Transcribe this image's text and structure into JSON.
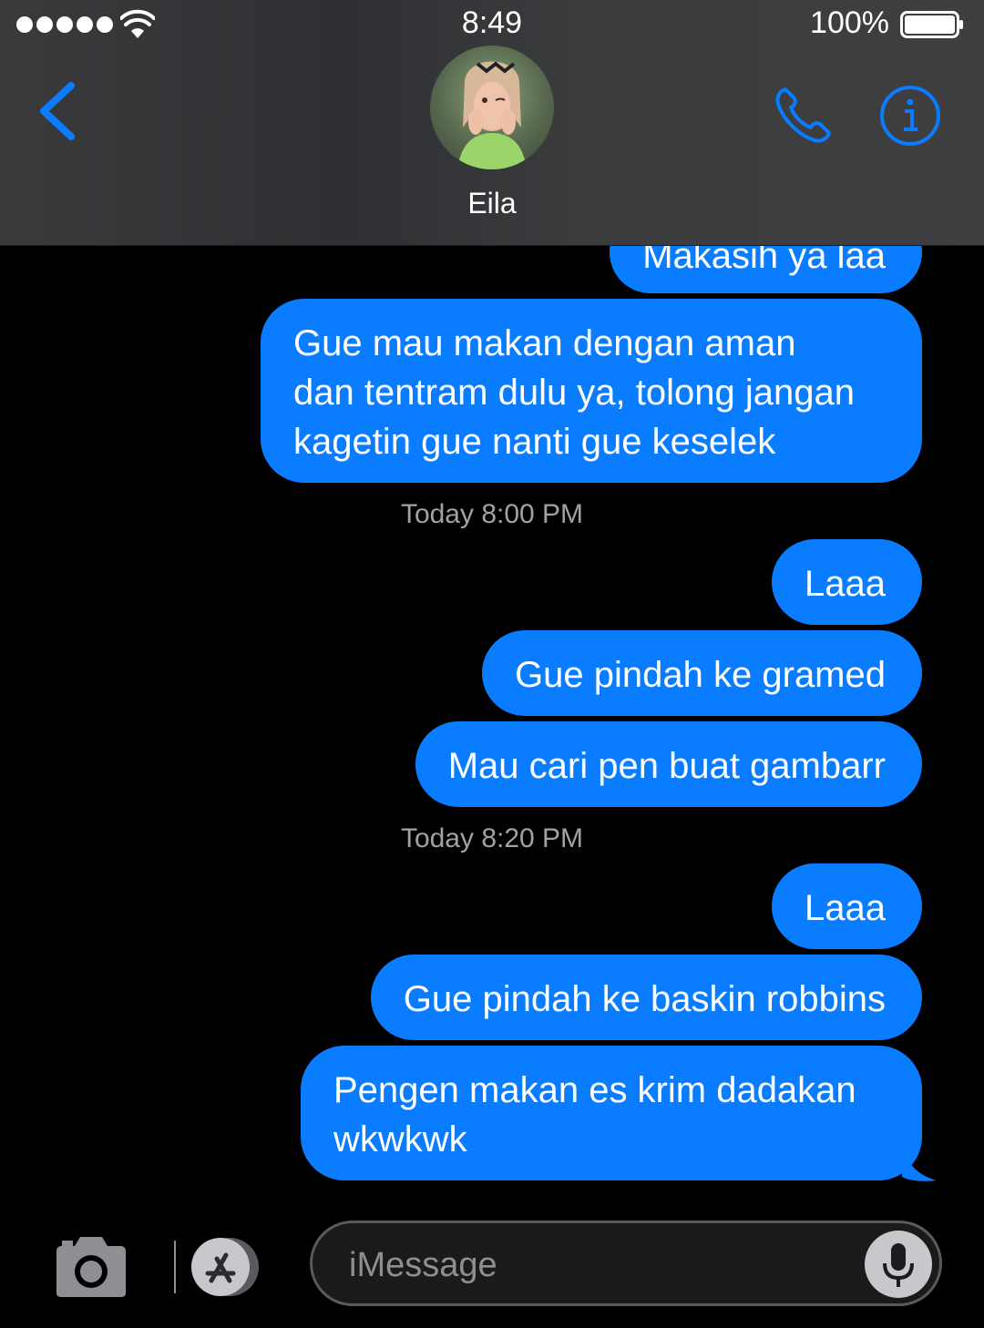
{
  "status_bar": {
    "time": "8:49",
    "battery_percent": "100%"
  },
  "header": {
    "contact_name": "Eila",
    "icons": {
      "back": "chevron-left-icon",
      "call": "phone-icon",
      "info": "info-icon"
    }
  },
  "messages": [
    {
      "kind": "sent",
      "text": "Makasih ya laa"
    },
    {
      "kind": "sent",
      "lines": [
        "Gue mau makan dengan aman",
        "dan tentram dulu ya, tolong jangan",
        "kagetin gue nanti gue keselek"
      ]
    },
    {
      "kind": "timestamp",
      "text": "Today 8:00 PM"
    },
    {
      "kind": "sent",
      "text": "Laaa"
    },
    {
      "kind": "sent",
      "text": "Gue pindah ke gramed"
    },
    {
      "kind": "sent",
      "text": "Mau cari pen buat gambarr"
    },
    {
      "kind": "timestamp",
      "text": "Today 8:20 PM"
    },
    {
      "kind": "sent",
      "text": "Laaa"
    },
    {
      "kind": "sent",
      "text": "Gue pindah ke baskin robbins"
    },
    {
      "kind": "sent",
      "lines": [
        "Pengen makan es krim dadakan",
        "wkwkwk"
      ]
    }
  ],
  "input_bar": {
    "placeholder": "iMessage",
    "value": "",
    "icons": {
      "camera": "camera-icon",
      "apps": "app-store-icon",
      "mic": "microphone-icon"
    }
  },
  "colors": {
    "bubble": "#0a7cff",
    "accent": "#0a7cff",
    "timestamp": "#a1a1a6",
    "background": "#000000"
  }
}
